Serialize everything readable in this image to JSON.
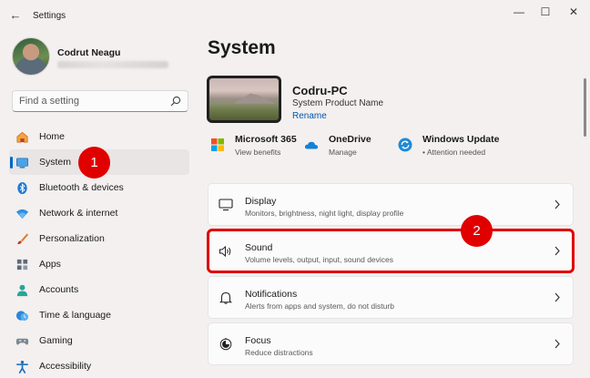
{
  "window": {
    "title": "Settings",
    "back_glyph": "←",
    "min_glyph": "—",
    "max_glyph": "☐",
    "close_glyph": "✕"
  },
  "profile": {
    "name": "Codrut Neagu"
  },
  "search": {
    "placeholder": "Find a setting"
  },
  "nav": {
    "items": [
      {
        "label": "Home",
        "icon": "home-icon"
      },
      {
        "label": "System",
        "icon": "system-icon",
        "active": true
      },
      {
        "label": "Bluetooth & devices",
        "icon": "bluetooth-icon"
      },
      {
        "label": "Network & internet",
        "icon": "wifi-icon"
      },
      {
        "label": "Personalization",
        "icon": "brush-icon"
      },
      {
        "label": "Apps",
        "icon": "apps-icon"
      },
      {
        "label": "Accounts",
        "icon": "accounts-icon"
      },
      {
        "label": "Time & language",
        "icon": "time-language-icon"
      },
      {
        "label": "Gaming",
        "icon": "gaming-icon"
      },
      {
        "label": "Accessibility",
        "icon": "accessibility-icon"
      }
    ]
  },
  "annotations": {
    "badge1": "1",
    "badge2": "2"
  },
  "main": {
    "title": "System",
    "device": {
      "name": "Codru-PC",
      "model": "System Product Name",
      "rename": "Rename"
    },
    "quick_links": [
      {
        "title": "Microsoft 365",
        "subtitle": "View benefits",
        "icon": "microsoft-365-icon"
      },
      {
        "title": "OneDrive",
        "subtitle": "Manage",
        "icon": "onedrive-icon"
      },
      {
        "title": "Windows Update",
        "subtitle": "• Attention needed",
        "icon": "windows-update-icon"
      }
    ],
    "cards": [
      {
        "title": "Display",
        "subtitle": "Monitors, brightness, night light, display profile",
        "icon": "display-icon"
      },
      {
        "title": "Sound",
        "subtitle": "Volume levels, output, input, sound devices",
        "icon": "sound-icon",
        "highlighted": true
      },
      {
        "title": "Notifications",
        "subtitle": "Alerts from apps and system, do not disturb",
        "icon": "bell-icon"
      },
      {
        "title": "Focus",
        "subtitle": "Reduce distractions",
        "icon": "focus-icon"
      }
    ]
  },
  "colors": {
    "accent": "#0067c0",
    "annotation_red": "#e00000",
    "background": "#f3f0ef",
    "card": "#fbfbfb"
  }
}
